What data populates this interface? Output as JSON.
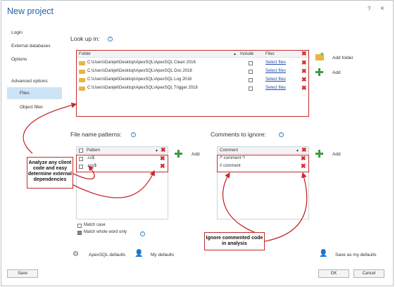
{
  "window": {
    "title": "New project",
    "help": "?",
    "close": "×"
  },
  "sidebar": {
    "items": [
      {
        "label": "Login"
      },
      {
        "label": "External databases"
      },
      {
        "label": "Options"
      },
      {
        "label": "Advanced options"
      },
      {
        "label": "Files"
      },
      {
        "label": "Object filter"
      }
    ],
    "selected": "Files"
  },
  "lookup": {
    "label": "Look up in:",
    "headers": {
      "folder": "Folder",
      "include": "Include",
      "files": "Files"
    },
    "rows": [
      {
        "path": "C:\\Users\\Danijel\\Desktop\\ApexSQL\\ApexSQL Clean 2016",
        "include": false,
        "files": "Select files"
      },
      {
        "path": "C:\\Users\\Danijel\\Desktop\\ApexSQL\\ApexSQL Doc 2016",
        "include": false,
        "files": "Select files"
      },
      {
        "path": "C:\\Users\\Danijel\\Desktop\\ApexSQL\\ApexSQL Log 2016",
        "include": false,
        "files": "Select files"
      },
      {
        "path": "C:\\Users\\Danijel\\Desktop\\ApexSQL\\ApexSQL Trigger 2016",
        "include": false,
        "files": "Select files"
      }
    ],
    "add_folder": "Add folder",
    "add": "Add"
  },
  "patterns": {
    "label": "File name patterns:",
    "header": "Pattern",
    "rows": [
      {
        "value": ".cs$",
        "checked": false
      },
      {
        "value": ".css$",
        "checked": false
      }
    ],
    "add": "Add",
    "match_case": "Match case",
    "match_case_checked": false,
    "match_whole": "Match whole word only",
    "match_whole_checked": true
  },
  "comments": {
    "label": "Comments to ignore:",
    "header": "Comment",
    "rows": [
      {
        "value": "/* comment */"
      },
      {
        "value": "// comment"
      }
    ],
    "add": "Add"
  },
  "callouts": {
    "left": "Analyze any client code and easy determine external dependencies",
    "right": "Ignore commented code in analysis"
  },
  "footer": {
    "apex_defaults": "ApexSQL defaults",
    "my_defaults": "My defaults",
    "save_as_my_defaults": "Save as my defaults",
    "save": "Save",
    "ok": "OK",
    "cancel": "Cancel"
  },
  "colors": {
    "title": "#2a62a8",
    "highlight": "#c52b2b",
    "selection": "#cde3f6",
    "add_green": "#3d9a45"
  }
}
